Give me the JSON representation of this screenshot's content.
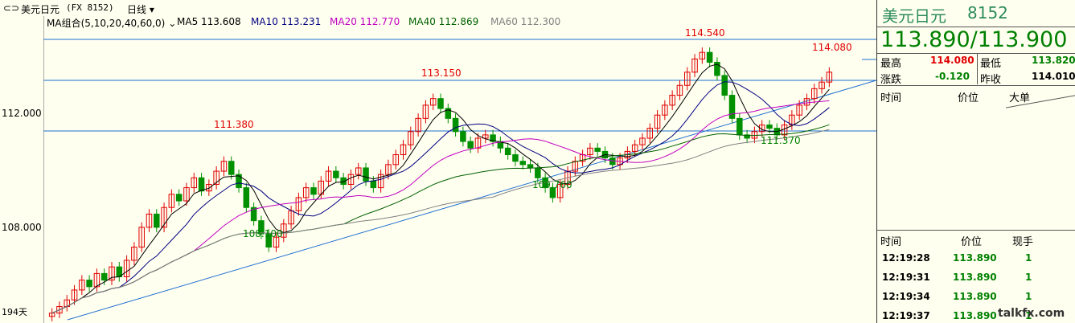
{
  "header": {
    "symbol_label": "美元日元",
    "symbol_code": "(FX 8152)",
    "period": "日线",
    "period_arrow": "▾"
  },
  "ma": {
    "group_label": "MA组合(5,10,20,40,60,0)",
    "group_arrow": "⌄",
    "items": [
      {
        "label": "MA5 113.608",
        "color": "#000000"
      },
      {
        "label": "MA10 113.231",
        "color": "#000080"
      },
      {
        "label": "MA20 112.770",
        "color": "#c000c0"
      },
      {
        "label": "MA40 112.869",
        "color": "#006000"
      },
      {
        "label": "MA60 112.300",
        "color": "#808080"
      }
    ]
  },
  "axis": {
    "ticks": [
      "112.000",
      "108.000"
    ],
    "bottom_label": "194天"
  },
  "annotations": {
    "a1": "111.380",
    "a2": "108.100",
    "a3": "113.150",
    "a4": "109.760",
    "a5": "114.540",
    "a6": "114.080",
    "a7": "111.370"
  },
  "panel": {
    "name": "美元日元",
    "code": "8152",
    "price": "113.890/113.900",
    "high_label": "最高",
    "high_value": "114.080",
    "low_label": "最低",
    "low_value": "113.820",
    "change_label": "涨跌",
    "change_value": "-0.120",
    "prev_label": "昨收",
    "prev_value": "114.010",
    "big_headers": [
      "时间",
      "价位",
      "大单"
    ],
    "tick_headers": [
      "时间",
      "价位",
      "现手"
    ],
    "ticks": [
      {
        "time": "12:19:28",
        "price": "113.890",
        "vol": "1"
      },
      {
        "time": "12:19:31",
        "price": "113.890",
        "vol": "1"
      },
      {
        "time": "12:19:34",
        "price": "113.890",
        "vol": "1"
      },
      {
        "time": "12:19:37",
        "price": "113.890",
        "vol": "1"
      }
    ],
    "watermark": "talkfx.com"
  },
  "colors": {
    "up": "#e00000",
    "down": "#009000",
    "trend": "#1e6fd0",
    "accent_red": "#ff0000",
    "accent_green": "#008000"
  },
  "chart_data": {
    "type": "candlestick",
    "ylim": [
      106.3,
      115.6
    ],
    "closes": [
      106.6,
      106.8,
      107.0,
      107.3,
      107.6,
      107.4,
      107.8,
      107.6,
      108.0,
      107.7,
      108.2,
      108.6,
      109.2,
      109.6,
      109.2,
      109.8,
      110.2,
      110.0,
      110.4,
      110.7,
      110.3,
      110.5,
      110.9,
      111.2,
      110.8,
      110.4,
      109.8,
      109.4,
      109.0,
      108.6,
      108.9,
      109.3,
      109.7,
      110.1,
      110.4,
      110.2,
      110.6,
      110.9,
      110.7,
      110.5,
      110.8,
      111.0,
      110.6,
      110.4,
      110.8,
      111.1,
      111.4,
      111.7,
      112.1,
      112.5,
      112.9,
      113.1,
      112.8,
      112.5,
      112.1,
      111.8,
      111.6,
      111.9,
      112.0,
      111.8,
      111.6,
      111.4,
      111.2,
      111.1,
      111.0,
      110.7,
      110.4,
      110.1,
      110.5,
      110.9,
      111.2,
      111.4,
      111.6,
      111.5,
      111.3,
      111.1,
      111.3,
      111.5,
      111.7,
      111.9,
      112.2,
      112.6,
      112.9,
      113.2,
      113.5,
      113.9,
      114.3,
      114.5,
      114.2,
      113.8,
      113.2,
      112.5,
      112.0,
      111.9,
      112.1,
      112.3,
      112.2,
      112.0,
      112.3,
      112.6,
      112.9,
      113.1,
      113.4,
      113.6,
      113.9
    ]
  }
}
